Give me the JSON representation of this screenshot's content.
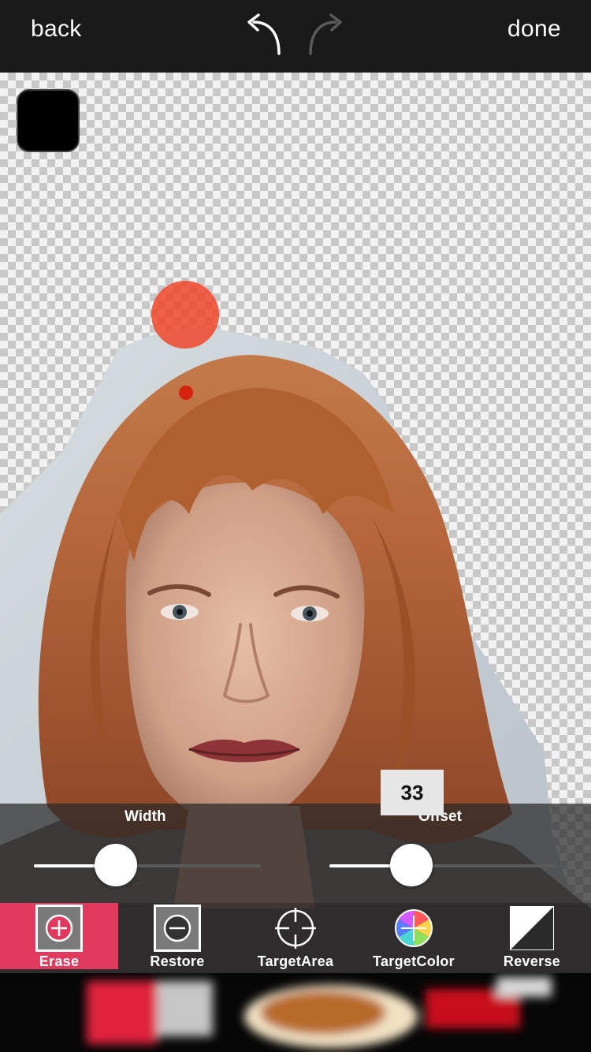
{
  "header": {
    "back_label": "back",
    "done_label": "done"
  },
  "canvas": {
    "background_swatch_color": "#000000",
    "brush_color": "#f0462c",
    "brush_point_color": "#d6220e"
  },
  "sliders": {
    "width": {
      "label": "Width",
      "value_fraction": 0.36
    },
    "offset": {
      "label": "Offset",
      "value": "33",
      "value_fraction": 0.36
    }
  },
  "toolbar": {
    "active_color": "#e23a5e",
    "tools": [
      {
        "label": "Erase",
        "icon": "erase-plus-icon",
        "active": true
      },
      {
        "label": "Restore",
        "icon": "restore-minus-icon",
        "active": false
      },
      {
        "label": "TargetArea",
        "icon": "crosshair-icon",
        "active": false
      },
      {
        "label": "TargetColor",
        "icon": "color-wheel-icon",
        "active": false
      },
      {
        "label": "Reverse",
        "icon": "reverse-diagonal-icon",
        "active": false
      }
    ]
  }
}
